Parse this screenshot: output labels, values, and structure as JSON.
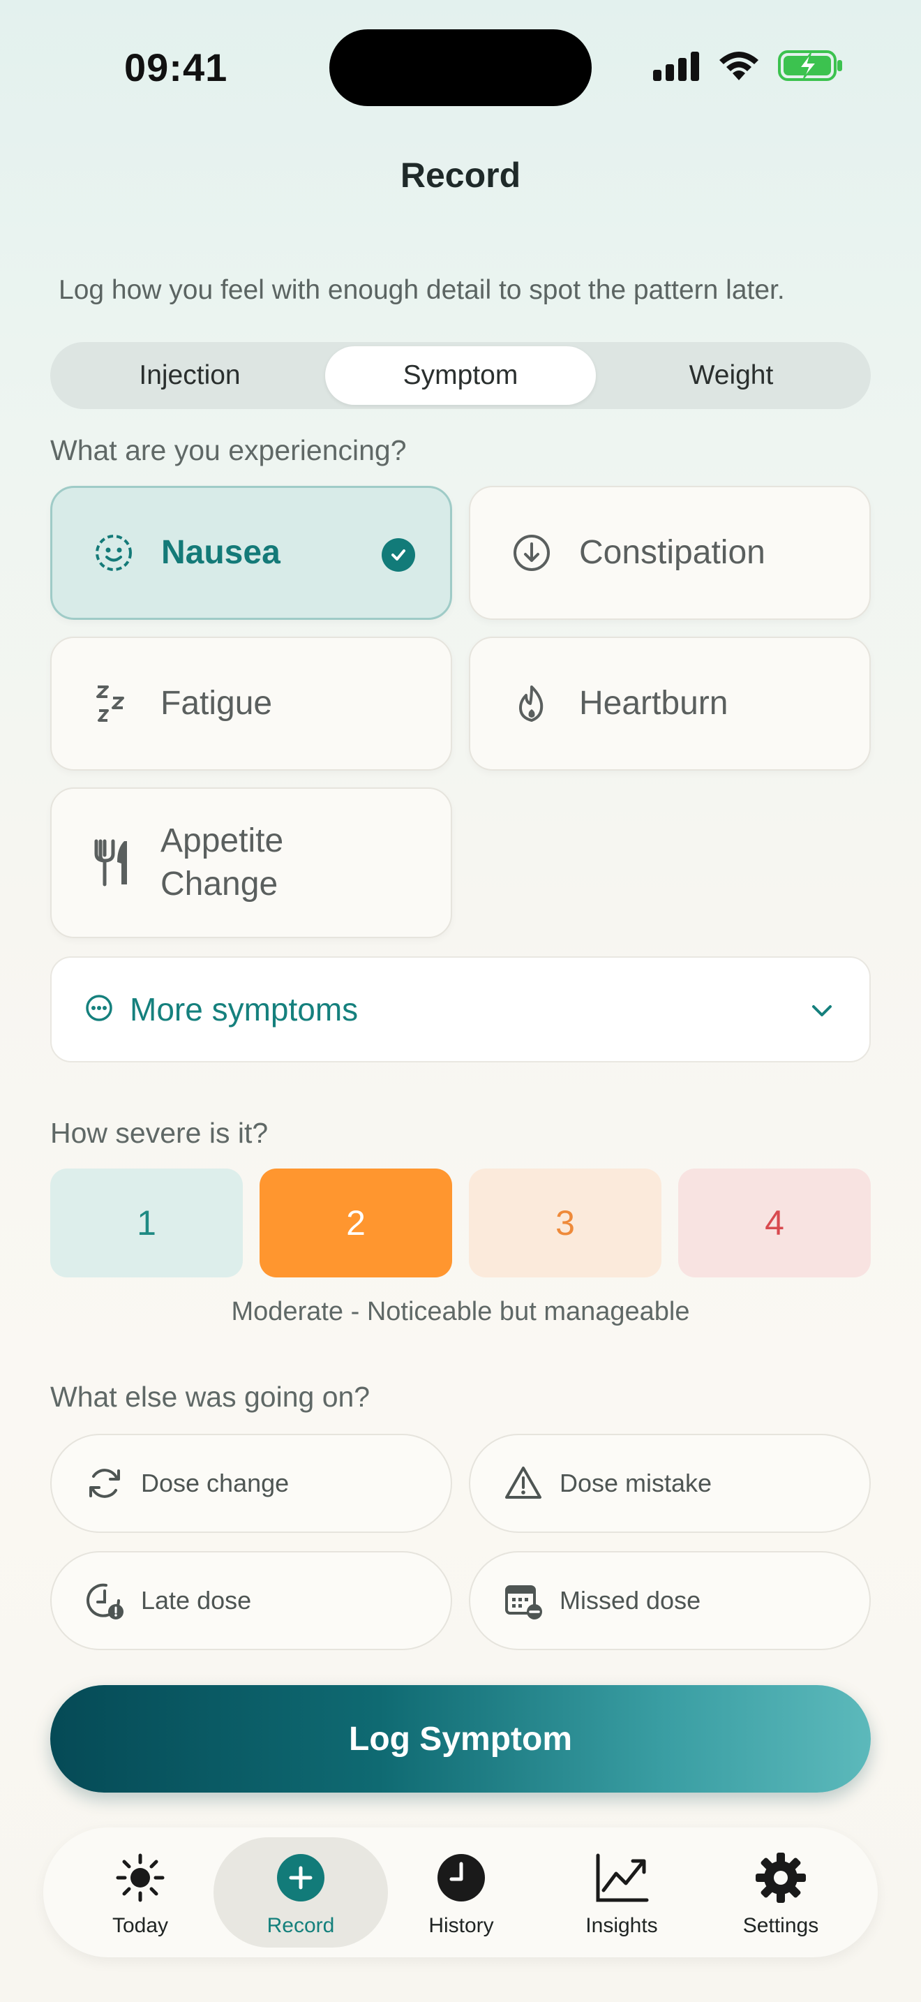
{
  "status_bar": {
    "time": "09:41"
  },
  "header": {
    "title": "Record"
  },
  "intro": "Log how you feel with enough detail to spot the pattern later.",
  "segments": [
    {
      "label": "Injection",
      "active": false
    },
    {
      "label": "Symptom",
      "active": true
    },
    {
      "label": "Weight",
      "active": false
    }
  ],
  "symptoms_section": {
    "label": "What are you experiencing?",
    "items": [
      {
        "label": "Nausea",
        "icon": "face-dashed-icon",
        "selected": true
      },
      {
        "label": "Constipation",
        "icon": "arrow-down-circle-icon",
        "selected": false
      },
      {
        "label": "Fatigue",
        "icon": "zzz-icon",
        "selected": false
      },
      {
        "label": "Heartburn",
        "icon": "flame-icon",
        "selected": false
      },
      {
        "label_line1": "Appetite",
        "label_line2": "Change",
        "icon": "fork-knife-icon",
        "selected": false
      }
    ],
    "more": "More symptoms"
  },
  "severity": {
    "label": "How severe is it?",
    "levels": [
      "1",
      "2",
      "3",
      "4"
    ],
    "selected": "2",
    "caption": "Moderate - Noticeable but manageable",
    "colors": {
      "level1_bg": "#ddeeeb",
      "level1_fg": "#1f8a83",
      "level2_bg": "#ff962f",
      "level2_fg": "#ffffff",
      "level3_bg": "#fbeadb",
      "level3_fg": "#ee8a3a",
      "level4_bg": "#f8e3e1",
      "level4_fg": "#d84a4f"
    }
  },
  "context": {
    "label": "What else was going on?",
    "chips": [
      {
        "label": "Dose change",
        "icon": "refresh-icon"
      },
      {
        "label": "Dose mistake",
        "icon": "warning-icon"
      },
      {
        "label": "Late dose",
        "icon": "clock-alert-icon"
      },
      {
        "label": "Missed dose",
        "icon": "calendar-minus-icon"
      }
    ]
  },
  "cta": {
    "label": "Log Symptom"
  },
  "tabbar": [
    {
      "label": "Today",
      "icon": "sun-icon"
    },
    {
      "label": "Record",
      "icon": "plus-circle-icon",
      "active": true
    },
    {
      "label": "History",
      "icon": "clock-icon"
    },
    {
      "label": "Insights",
      "icon": "chart-line-icon"
    },
    {
      "label": "Settings",
      "icon": "gear-icon"
    }
  ],
  "colors": {
    "accent": "#127b79",
    "selected_orange": "#ff962f"
  }
}
